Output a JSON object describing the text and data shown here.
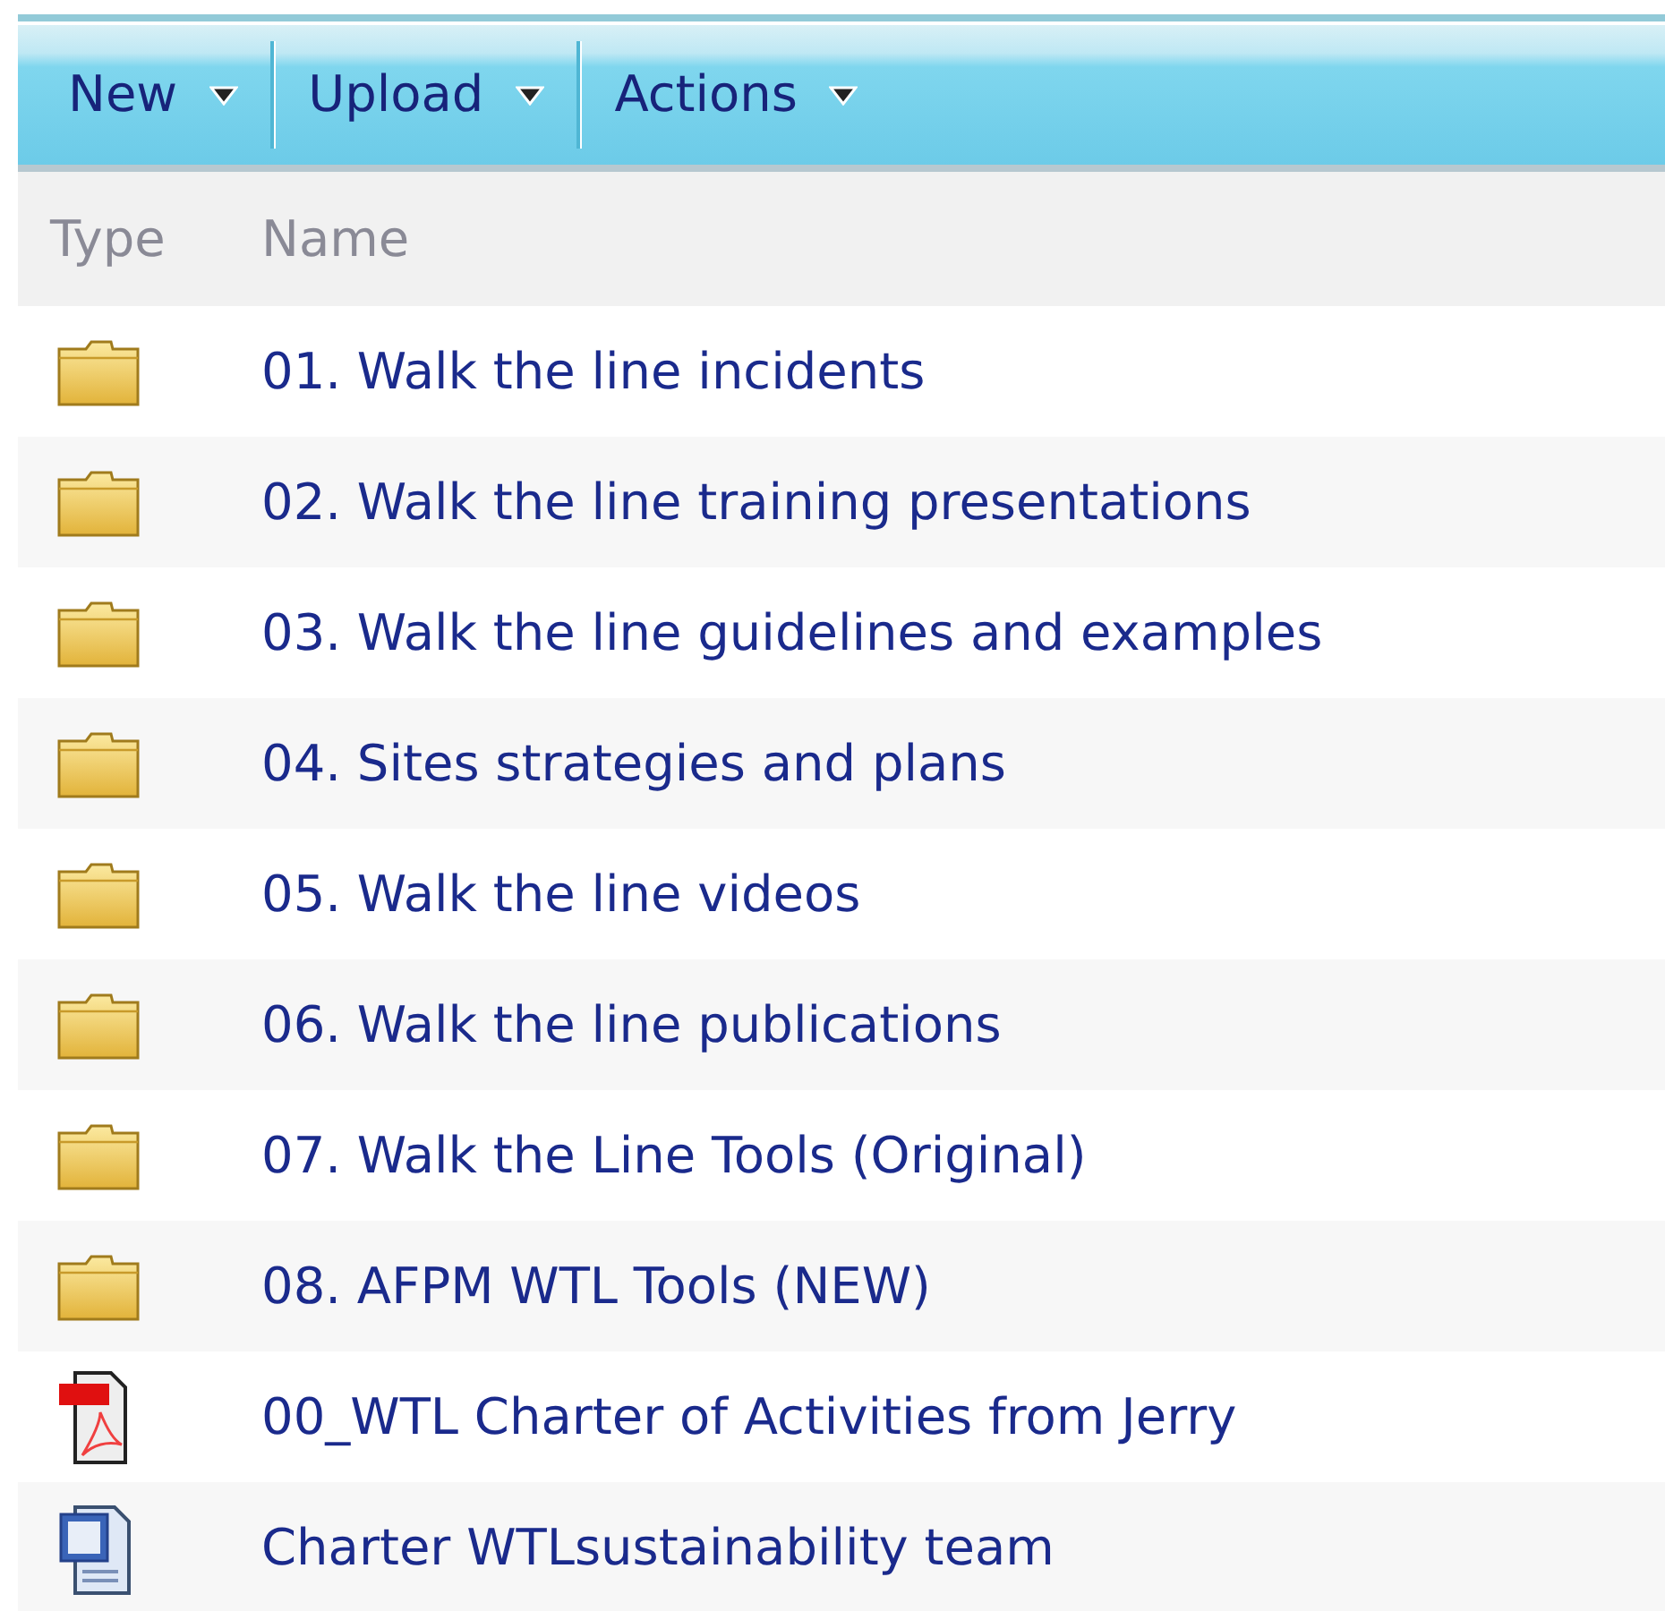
{
  "toolbar": [
    {
      "label": "New"
    },
    {
      "label": "Upload"
    },
    {
      "label": "Actions"
    }
  ],
  "columns": [
    "Type",
    "Name"
  ],
  "rows": [
    {
      "kind": "folder",
      "name": "01. Walk the line incidents"
    },
    {
      "kind": "folder",
      "name": "02. Walk the line training presentations"
    },
    {
      "kind": "folder",
      "name": "03. Walk the line guidelines and examples"
    },
    {
      "kind": "folder",
      "name": "04. Sites strategies and plans"
    },
    {
      "kind": "folder",
      "name": "05. Walk the line videos"
    },
    {
      "kind": "folder",
      "name": "06. Walk the line publications"
    },
    {
      "kind": "folder",
      "name": "07. Walk the Line Tools (Original)"
    },
    {
      "kind": "folder",
      "name": "08. AFPM WTL Tools (NEW)"
    },
    {
      "kind": "pdf",
      "name": "00_WTL Charter of Activities from Jerry"
    },
    {
      "kind": "doc",
      "name": "Charter WTLsustainability team"
    }
  ]
}
